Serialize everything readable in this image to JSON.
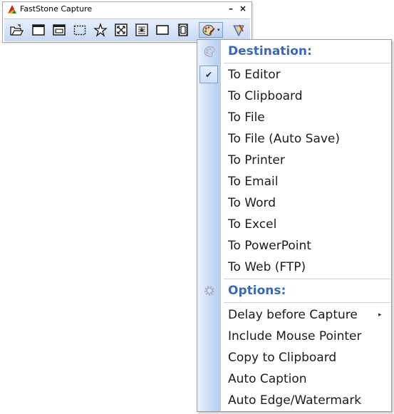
{
  "window": {
    "title": "FastStone Capture",
    "minimize_glyph": "–",
    "close_glyph": "×"
  },
  "toolbar": {
    "buttons": [
      {
        "name": "open-file-icon"
      },
      {
        "name": "capture-active-window-icon"
      },
      {
        "name": "capture-window-object-icon"
      },
      {
        "name": "capture-rectangular-region-icon"
      },
      {
        "name": "capture-freehand-region-icon"
      },
      {
        "name": "capture-full-screen-icon"
      },
      {
        "name": "capture-scrolling-window-icon"
      },
      {
        "name": "capture-fixed-region-icon"
      },
      {
        "name": "screen-recorder-icon"
      },
      {
        "name": "output-destination-icon"
      },
      {
        "name": "settings-icon"
      }
    ],
    "dropdown_arrow": "▾"
  },
  "menu": {
    "destination_header": "Destination:",
    "destinations": [
      {
        "label": "To Editor",
        "checked": true
      },
      {
        "label": "To Clipboard",
        "checked": false
      },
      {
        "label": "To File",
        "checked": false
      },
      {
        "label": "To File (Auto Save)",
        "checked": false
      },
      {
        "label": "To Printer",
        "checked": false
      },
      {
        "label": "To Email",
        "checked": false
      },
      {
        "label": "To Word",
        "checked": false
      },
      {
        "label": "To Excel",
        "checked": false
      },
      {
        "label": "To PowerPoint",
        "checked": false
      },
      {
        "label": "To Web (FTP)",
        "checked": false
      }
    ],
    "options_header": "Options:",
    "options": [
      {
        "label": "Delay before Capture",
        "has_submenu": true
      },
      {
        "label": "Include Mouse Pointer",
        "has_submenu": false
      },
      {
        "label": "Copy to Clipboard",
        "has_submenu": false
      },
      {
        "label": "Auto Caption",
        "has_submenu": false
      },
      {
        "label": "Auto Edge/Watermark",
        "has_submenu": false
      }
    ],
    "check_glyph": "✔",
    "submenu_glyph": "▸"
  },
  "colors": {
    "header_text": "#3b69b6",
    "toolbar_bg": "#c7d8f3",
    "gutter_bg": "#c8dbf5"
  }
}
